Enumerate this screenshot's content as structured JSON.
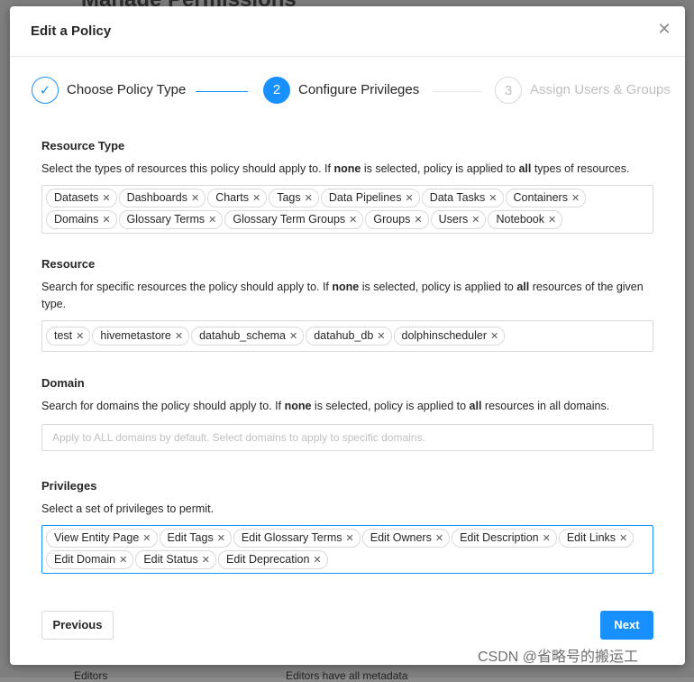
{
  "background": {
    "page_title": "Manage Permissions",
    "row_label": "Editors",
    "row_desc": "Editors have all metadata"
  },
  "modal": {
    "title": "Edit a Policy",
    "close_icon": "close-icon"
  },
  "steps": [
    {
      "index": "✓",
      "label": "Choose Policy Type",
      "state": "done"
    },
    {
      "index": "2",
      "label": "Configure Privileges",
      "state": "active"
    },
    {
      "index": "3",
      "label": "Assign Users & Groups",
      "state": "pending"
    }
  ],
  "resource_type": {
    "title": "Resource Type",
    "desc_pre": "Select the types of resources this policy should apply to. If ",
    "desc_none": "none",
    "desc_mid": " is selected, policy is applied to ",
    "desc_all": "all",
    "desc_post": " types of resources.",
    "tags": [
      "Datasets",
      "Dashboards",
      "Charts",
      "Tags",
      "Data Pipelines",
      "Data Tasks",
      "Containers",
      "Domains",
      "Glossary Terms",
      "Glossary Term Groups",
      "Groups",
      "Users",
      "Notebook"
    ]
  },
  "resource": {
    "title": "Resource",
    "desc_pre": "Search for specific resources the policy should apply to. If ",
    "desc_none": "none",
    "desc_mid": " is selected, policy is applied to ",
    "desc_all": "all",
    "desc_post": " resources of the given type.",
    "tags": [
      "test",
      "hivemetastore",
      "datahub_schema",
      "datahub_db",
      "dolphinscheduler"
    ]
  },
  "domain": {
    "title": "Domain",
    "desc_pre": "Search for domains the policy should apply to. If ",
    "desc_none": "none",
    "desc_mid": " is selected, policy is applied to ",
    "desc_all": "all",
    "desc_post": " resources in all domains.",
    "placeholder": "Apply to ALL domains by default. Select domains to apply to specific domains."
  },
  "privileges": {
    "title": "Privileges",
    "desc": "Select a set of privileges to permit.",
    "tags": [
      "View Entity Page",
      "Edit Tags",
      "Edit Glossary Terms",
      "Edit Owners",
      "Edit Description",
      "Edit Links",
      "Edit Domain",
      "Edit Status",
      "Edit Deprecation"
    ]
  },
  "footer": {
    "previous_label": "Previous",
    "next_label": "Next"
  },
  "watermark": "CSDN @省略号的搬运工",
  "colors": {
    "accent": "#1890ff",
    "border": "#d9d9d9",
    "muted": "#bfbfbf"
  }
}
